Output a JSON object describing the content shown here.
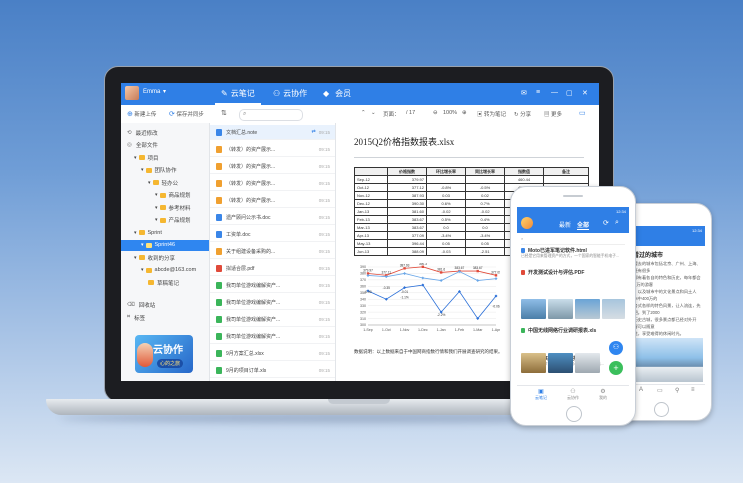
{
  "app": {
    "user": "Emma",
    "tabs": [
      {
        "label": "云笔记",
        "active": true
      },
      {
        "label": "云协作",
        "active": false
      },
      {
        "label": "会员",
        "active": false
      }
    ],
    "accent": "#2f7fe6"
  },
  "toolbar": {
    "new_upload": "新建上传",
    "save_sync": "保存并同步",
    "page_info": "/ 17",
    "zoom": "100%",
    "convert": "转为笔记",
    "share": "分享",
    "more": "更多"
  },
  "sidebar": {
    "items": [
      {
        "label": "最近修改",
        "level": 0
      },
      {
        "label": "全部文件",
        "level": 0
      },
      {
        "label": "项目",
        "level": 1
      },
      {
        "label": "团队协作",
        "level": 2
      },
      {
        "label": "轻办公",
        "level": 3
      },
      {
        "label": "商品规划",
        "level": 4
      },
      {
        "label": "参考材料",
        "level": 4
      },
      {
        "label": "产品规划",
        "level": 4
      },
      {
        "label": "Sprint",
        "level": 1
      },
      {
        "label": "Sprint46",
        "level": 2,
        "selected": true
      },
      {
        "label": "收到的分享",
        "level": 1
      },
      {
        "label": "abcde@163.com",
        "level": 2
      },
      {
        "label": "草稿笔记",
        "level": 3
      },
      {
        "label": "回收站",
        "level": 0
      },
      {
        "label": "标签",
        "level": 0
      }
    ],
    "promo_title": "云协作",
    "promo_sub": "心的之旅"
  },
  "file_list": {
    "items": [
      {
        "name": "文档汇总.note",
        "time": "09:15",
        "color": "#3a86e8",
        "selected": true
      },
      {
        "name": "（转发）的资产展示...",
        "time": "09:15",
        "color": "#f0a030"
      },
      {
        "name": "（转发）的资产展示...",
        "time": "09:15",
        "color": "#f0a030"
      },
      {
        "name": "（转发）的资产展示...",
        "time": "09:15",
        "color": "#f0a030"
      },
      {
        "name": "（转发）的资产展示...",
        "time": "09:15",
        "color": "#f0a030"
      },
      {
        "name": "遗产顾问公示书.doc",
        "time": "09:15",
        "color": "#3a86e8"
      },
      {
        "name": "工资单.doc",
        "time": "09:15",
        "color": "#3a86e8"
      },
      {
        "name": "关于组建设备采购的...",
        "time": "09:15",
        "color": "#f0a030"
      },
      {
        "name": "拟适合层.pdf",
        "time": "09:15",
        "color": "#e04a3a"
      },
      {
        "name": "我司单位游戏编解资产...",
        "time": "09:15",
        "color": "#3bb55a"
      },
      {
        "name": "我司单位游戏编解资产...",
        "time": "09:15",
        "color": "#3bb55a"
      },
      {
        "name": "我司单位游戏编解资产...",
        "time": "09:15",
        "color": "#3bb55a"
      },
      {
        "name": "我司单位游戏编解资产...",
        "time": "09:15",
        "color": "#3bb55a"
      },
      {
        "name": "9月方案汇总.xlsx",
        "time": "09:15",
        "color": "#3bb55a"
      },
      {
        "name": "9月的项目订单.xls",
        "time": "09:15",
        "color": "#3bb55a"
      }
    ]
  },
  "document": {
    "title": "2015Q2价格指数报表.xlsx",
    "columns": [
      "",
      "价格指数",
      "环比增长率",
      "同比增长率",
      "指数值",
      "备注"
    ],
    "rows": [
      [
        "Sep-12",
        "379.97",
        "",
        "",
        "460.44",
        ""
      ],
      [
        "Oct-12",
        "377.12",
        "-0.8%",
        "-0.5%",
        "456.66",
        ""
      ],
      [
        "Nov-12",
        "387.93",
        "0.03",
        "0.02",
        "420.48",
        ""
      ],
      [
        "Dec-12",
        "390.30",
        "0.6%",
        "0.7%",
        "410.97",
        ""
      ],
      [
        "Jan-13",
        "381.60",
        "-0.02",
        "-0.02",
        "404.67",
        ""
      ],
      [
        "Feb-13",
        "383.67",
        "0.5%",
        "0.4%",
        "400.89",
        ""
      ],
      [
        "Mar-13",
        "383.67",
        "0.0",
        "0.0",
        "",
        ""
      ],
      [
        "Apr-13",
        "377.09",
        "-3.4%",
        "-3.4%",
        "410.0",
        ""
      ],
      [
        "May-13",
        "396.44",
        "0.05",
        "0.05",
        "",
        ""
      ],
      [
        "Jun-13",
        "388.09",
        "-0.03",
        "-2.51",
        "398.0",
        ""
      ]
    ],
    "caption": "数据说明：以上数据来自于中国网商指数行情和我们开展调查研究的结果。"
  },
  "chart_data": {
    "type": "line",
    "categories": [
      "1-Sep",
      "1-Oct",
      "1-Nov",
      "1-Dec",
      "1-Jan",
      "1-Feb",
      "1-Mar",
      "1-Apr"
    ],
    "ylim": [
      300,
      390
    ],
    "yticks": [
      300,
      310,
      320,
      330,
      340,
      350,
      360,
      370,
      380,
      390
    ],
    "series": [
      {
        "values": [
          379.97,
          377.11,
          387.93,
          390.3,
          381.6,
          383.67,
          383.67,
          377.09
        ],
        "color": "#e04a3a",
        "marker": "square"
      },
      {
        "values": [
          376.87,
          375.0,
          380.0,
          373.0,
          369.0,
          383.0,
          369.0,
          372.0
        ],
        "color": "#6aa7e8",
        "marker": "diamond"
      },
      {
        "values": [
          353.0,
          340.0,
          358.0,
          362.0,
          320.0,
          352.0,
          310.0,
          345.0
        ],
        "color": "#2a6fd8",
        "marker": "diamond"
      }
    ],
    "data_labels": [
      {
        "text": "-0.00",
        "x": "1-Sep",
        "y": 350
      },
      {
        "text": "-0.35",
        "x": "1-Oct",
        "y": 356
      },
      {
        "text": "-1.1%",
        "x": "1-Nov",
        "y": 341
      },
      {
        "text": "-0.01",
        "x": "1-Nov",
        "y": 350
      },
      {
        "text": "-2.2%",
        "x": "1-Jan",
        "y": 314
      },
      {
        "text": "-0.06",
        "x": "1-Apr",
        "y": 327
      }
    ],
    "grid": true
  },
  "phone1": {
    "time": "12:34",
    "tabs": [
      "最新",
      "全部"
    ],
    "items": [
      {
        "title": "Moto已进军笔记软件.html",
        "sub": "已经是它用来管理资产的方式，一个国家的智能手机电子..."
      },
      {
        "title": "开发测试设计与评估.PDF",
        "sub": ""
      },
      {
        "title": "中国无线网络行业调研报表.xls",
        "sub": ""
      },
      {
        "title": "关于未来生产模式的报告.ppt",
        "sub": "文档整体分析介绍中介绍生产改革方式，并提出..."
      }
    ],
    "nav": [
      "云笔记",
      "云协作",
      "我的"
    ]
  },
  "phone2": {
    "time": "12:34",
    "heading": "关于看过的城市",
    "body": [
      "一直想要去的城市包括北京、广州、上海、杭州，还有很多",
      "的城市都有着各自的特色和历史，每年都会有900多万的游客",
      "的数量，以及城市中的文化景点和风土人情。城市中400万的",
      "人口，各式各样的特色风景，让人流连，先去看看吧。到了2000",
      "多年的历史古城，很多景点都已经对外开放，游客可以随意",
      "进入游览，享受难得的休闲时光。"
    ]
  }
}
